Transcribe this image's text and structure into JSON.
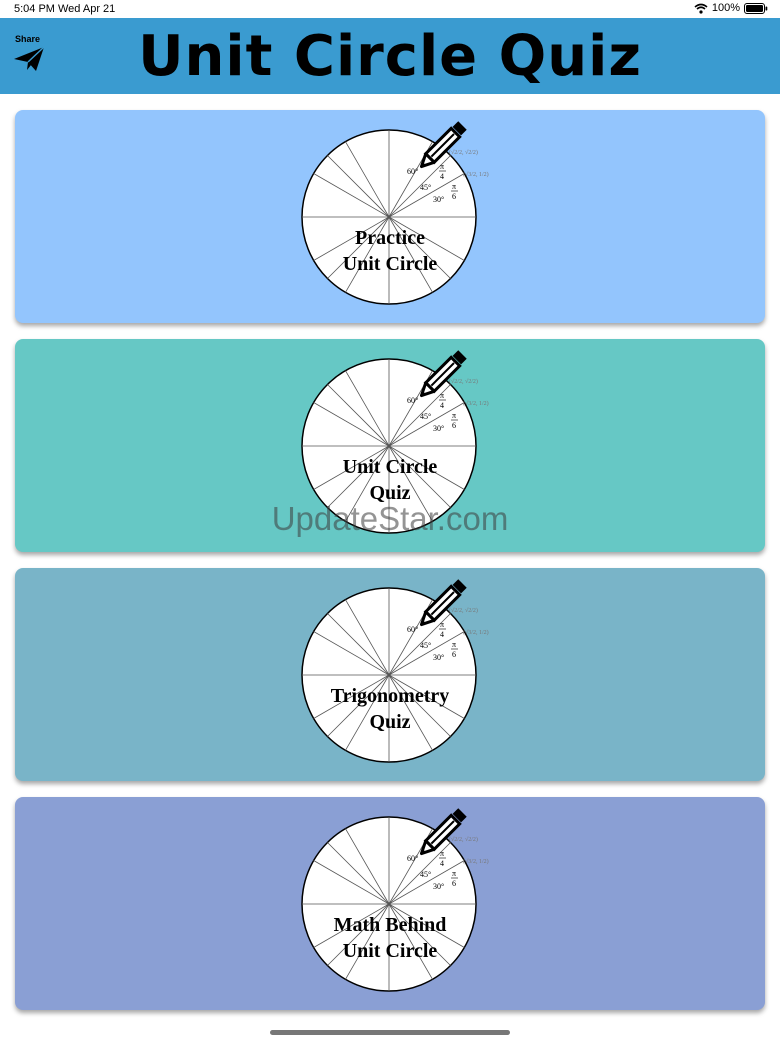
{
  "status_bar": {
    "time": "5:04 PM",
    "date": "Wed Apr 21",
    "battery": "100%",
    "icons": [
      "wifi-icon",
      "battery-icon"
    ]
  },
  "header": {
    "title": "Unit Circle Quiz",
    "share_label": "Share",
    "share_icon": "paper-plane-icon",
    "background": "#3a9bd0"
  },
  "cards": [
    {
      "line1": "Practice",
      "line2": "Unit Circle",
      "color": "#93c5fd"
    },
    {
      "line1": "Unit Circle",
      "line2": "Quiz",
      "color": "#66c8c5"
    },
    {
      "line1": "Trigonometry",
      "line2": "Quiz",
      "color": "#79b4c8"
    },
    {
      "line1": "Math Behind",
      "line2": "Unit Circle",
      "color": "#8a9fd4"
    }
  ],
  "circle_labels": {
    "deg60": "60°",
    "deg45": "45°",
    "deg30": "30°",
    "pi": "π",
    "four": "4",
    "six": "6",
    "coord_45": "(√2/2, √2/2)",
    "coord_30": "(√3/2, 1/2)"
  },
  "card_icons": [
    "unit-circle-icon",
    "pencil-icon"
  ],
  "watermark": "UpdateStar.com"
}
